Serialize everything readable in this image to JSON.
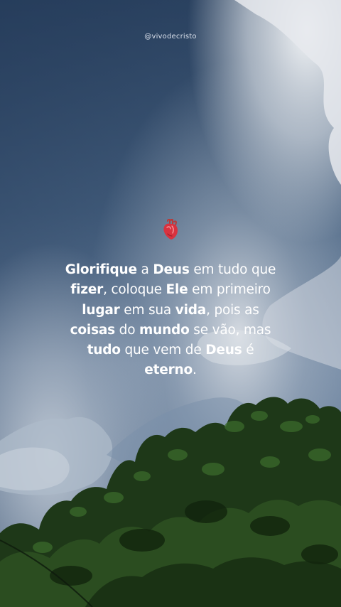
{
  "account": {
    "handle": "@vivodecristo"
  },
  "emoji": {
    "icon": "anatomical-heart-icon",
    "color": "#d8323f"
  },
  "quote": {
    "lines": [
      [
        {
          "t": "Glorifique",
          "b": true
        },
        {
          "t": " a ",
          "b": false
        },
        {
          "t": "Deus",
          "b": true
        },
        {
          "t": " em tudo que",
          "b": false
        }
      ],
      [
        {
          "t": "fizer",
          "b": true
        },
        {
          "t": ", coloque ",
          "b": false
        },
        {
          "t": "Ele",
          "b": true
        },
        {
          "t": " em primeiro",
          "b": false
        }
      ],
      [
        {
          "t": "lugar",
          "b": true
        },
        {
          "t": " em sua ",
          "b": false
        },
        {
          "t": "vida",
          "b": true
        },
        {
          "t": ", pois as",
          "b": false
        }
      ],
      [
        {
          "t": "coisas",
          "b": true
        },
        {
          "t": " do ",
          "b": false
        },
        {
          "t": "mundo",
          "b": true
        },
        {
          "t": " se vão, mas",
          "b": false
        }
      ],
      [
        {
          "t": "tudo",
          "b": true
        },
        {
          "t": " que vem de ",
          "b": false
        },
        {
          "t": "Deus",
          "b": true
        },
        {
          "t": " é",
          "b": false
        }
      ],
      [
        {
          "t": "eterno",
          "b": true
        },
        {
          "t": ".",
          "b": false
        }
      ]
    ]
  },
  "colors": {
    "sky_top": "#2f4a69",
    "sky_mid": "#6f88a6",
    "cloud_light": "#dfe4ea",
    "tree_dark": "#162a12",
    "tree_mid": "#2f5a22"
  }
}
